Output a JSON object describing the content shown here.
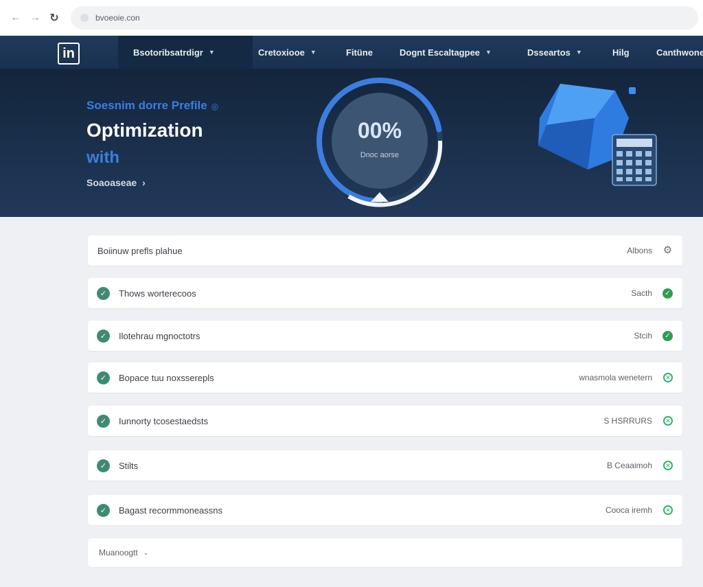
{
  "browser": {
    "url": "bvoeoie.con"
  },
  "nav": {
    "logo": "in",
    "items": [
      {
        "label": "Bsotoribsatrdigr",
        "caret": true
      },
      {
        "label": "Cretoxiooe",
        "caret": true
      },
      {
        "label": "Fitüne",
        "caret": false
      },
      {
        "label": "Dognt Escaltagpee",
        "caret": true
      },
      {
        "label": "Dsseartos",
        "caret": true
      },
      {
        "label": "Hilg",
        "caret": false
      },
      {
        "label": "Canthwone",
        "caret": false
      }
    ]
  },
  "hero": {
    "eyebrow": "Soesnim dorre Prefile",
    "title": "Optimization",
    "subtitle": "with",
    "link": "Soaoaseae",
    "gauge_value": "00%",
    "gauge_caption": "Dnoc aorse",
    "gauge_fraction": 0.72
  },
  "checklist": [
    {
      "label": "Boiinuw prefls plahue",
      "status": "Albons",
      "status_icon": "gear-icon",
      "checked": false
    },
    {
      "label": "Thows worterecoos",
      "status": "Sacth",
      "status_icon": "check-icon",
      "checked": true
    },
    {
      "label": "Ilotehrau mgnoctotrs",
      "status": "Stcih",
      "status_icon": "check-icon",
      "checked": true
    },
    {
      "label": "Bopace tuu noxsserepls",
      "status": "wnasmola wenetern",
      "status_icon": "pending-icon",
      "checked": true
    },
    {
      "label": "Iunnorty tcosestaedsts",
      "status": "S HSRRURS",
      "status_icon": "pending-icon",
      "checked": true
    },
    {
      "label": "Stilts",
      "status": "B Ceaaimoh",
      "status_icon": "pending-icon",
      "checked": true
    },
    {
      "label": "Bagast recormmoneassns",
      "status": "Cooca iremh",
      "status_icon": "pending-icon",
      "checked": true
    }
  ],
  "more": {
    "label": "Muanoogtt"
  },
  "colors": {
    "accent": "#3b7fe0",
    "nav_bg": "#1d3557",
    "check": "#3f8a72",
    "ok": "#2e9e4f"
  }
}
